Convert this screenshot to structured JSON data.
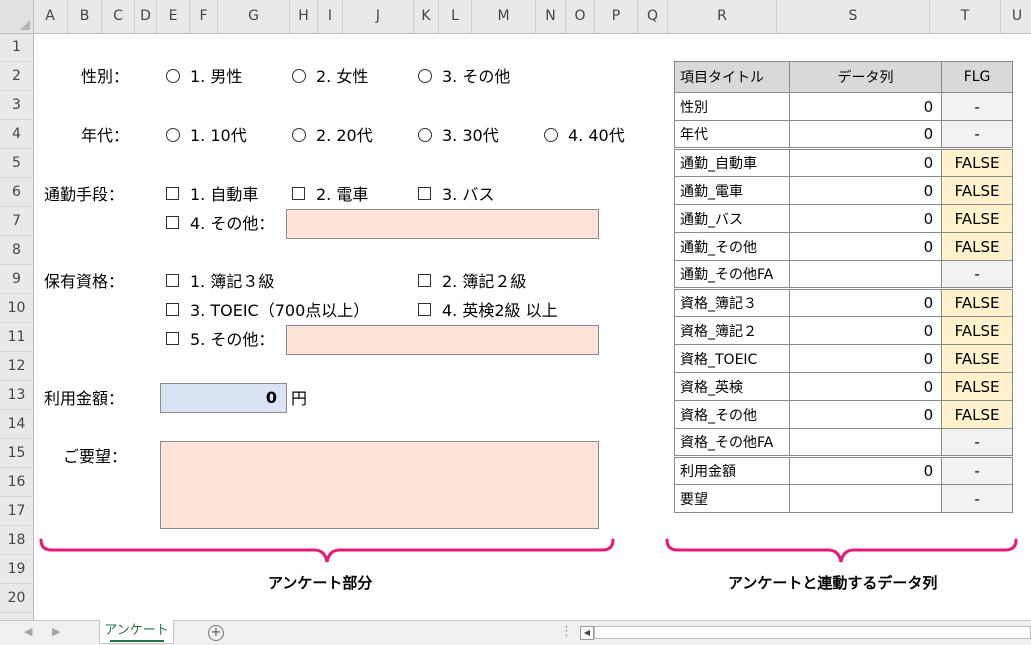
{
  "sheet": {
    "columns": [
      "A",
      "B",
      "C",
      "D",
      "E",
      "F",
      "G",
      "H",
      "I",
      "J",
      "K",
      "L",
      "M",
      "N",
      "O",
      "P",
      "Q",
      "R",
      "S",
      "T",
      "U"
    ],
    "rows": [
      "1",
      "2",
      "3",
      "4",
      "5",
      "6",
      "7",
      "8",
      "9",
      "10",
      "11",
      "12",
      "13",
      "14",
      "15",
      "16",
      "17",
      "18",
      "19",
      "20"
    ],
    "tab_label": "アンケート",
    "add_sheet_glyph": "+",
    "dots_glyph": "⋮"
  },
  "form": {
    "gender": {
      "label": "性別：",
      "options": [
        "1. 男性",
        "2. 女性",
        "3. その他"
      ]
    },
    "age": {
      "label": "年代：",
      "options": [
        "1. 10代",
        "2. 20代",
        "3. 30代",
        "4. 40代"
      ]
    },
    "commute": {
      "label": "通勤手段：",
      "options": [
        "1. 自動車",
        "2. 電車",
        "3. バス",
        "4. その他："
      ]
    },
    "quals": {
      "label": "保有資格：",
      "options": [
        "1. 簿記３級",
        "2. 簿記２級",
        "3. TOEIC（700点以上）",
        "4. 英検2級 以上",
        "5. その他："
      ]
    },
    "amount": {
      "label": "利用金額：",
      "value": "0",
      "unit": "円"
    },
    "request": {
      "label": "ご要望："
    }
  },
  "data_table": {
    "headers": [
      "項目タイトル",
      "データ列",
      "FLG"
    ],
    "rows": [
      {
        "title": "性別",
        "value": "0",
        "flg": "-"
      },
      {
        "title": "年代",
        "value": "0",
        "flg": "-"
      },
      {
        "title": "通勤_自動車",
        "value": "0",
        "flg": "FALSE"
      },
      {
        "title": "通勤_電車",
        "value": "0",
        "flg": "FALSE"
      },
      {
        "title": "通勤_バス",
        "value": "0",
        "flg": "FALSE"
      },
      {
        "title": "通勤_その他",
        "value": "0",
        "flg": "FALSE"
      },
      {
        "title": "通勤_その他FA",
        "value": "",
        "flg": "-"
      },
      {
        "title": "資格_簿記３",
        "value": "0",
        "flg": "FALSE"
      },
      {
        "title": "資格_簿記２",
        "value": "0",
        "flg": "FALSE"
      },
      {
        "title": "資格_TOEIC",
        "value": "0",
        "flg": "FALSE"
      },
      {
        "title": "資格_英検",
        "value": "0",
        "flg": "FALSE"
      },
      {
        "title": "資格_その他",
        "value": "0",
        "flg": "FALSE"
      },
      {
        "title": "資格_その他FA",
        "value": "",
        "flg": "-"
      },
      {
        "title": "利用金額",
        "value": "0",
        "flg": "-"
      },
      {
        "title": "要望",
        "value": "",
        "flg": "-"
      }
    ]
  },
  "captions": {
    "survey": "アンケート部分",
    "linked": "アンケートと連動するデータ列"
  },
  "colors": {
    "free_answer_bg": "#fde4d6",
    "amount_bg": "#dae3f3",
    "flg_false_bg": "#fff2cc",
    "brace": "#e6197a",
    "tab_text": "#217346"
  }
}
